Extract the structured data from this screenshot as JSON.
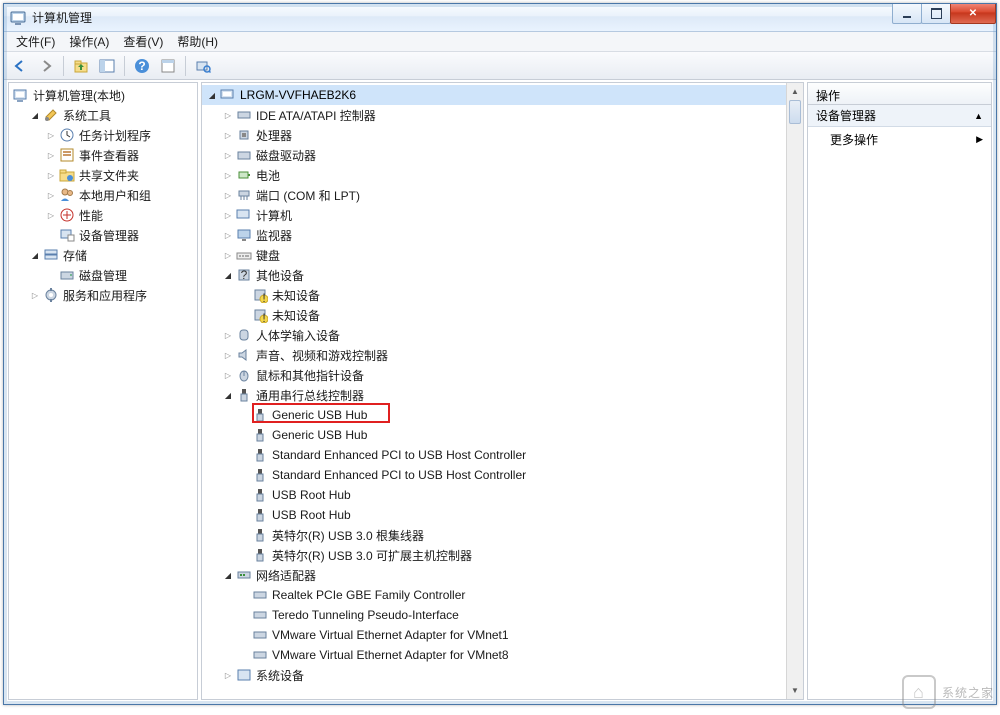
{
  "window": {
    "title": "计算机管理"
  },
  "menu": {
    "file": "文件(F)",
    "action": "操作(A)",
    "view": "查看(V)",
    "help": "帮助(H)"
  },
  "left_tree": {
    "root": "计算机管理(本地)",
    "systools": "系统工具",
    "task_scheduler": "任务计划程序",
    "event_viewer": "事件查看器",
    "shared_folders": "共享文件夹",
    "local_users": "本地用户和组",
    "performance": "性能",
    "device_manager": "设备管理器",
    "storage": "存储",
    "disk_mgmt": "磁盘管理",
    "services_apps": "服务和应用程序"
  },
  "mid_tree": {
    "computer": "LRGM-VVFHAEB2K6",
    "ide": "IDE ATA/ATAPI 控制器",
    "cpu": "处理器",
    "disk_drives": "磁盘驱动器",
    "battery": "电池",
    "ports": "端口 (COM 和 LPT)",
    "computers": "计算机",
    "monitors": "监视器",
    "keyboards": "键盘",
    "other_devices": "其他设备",
    "unknown1": "未知设备",
    "unknown2": "未知设备",
    "hid": "人体学输入设备",
    "sound": "声音、视频和游戏控制器",
    "mouse": "鼠标和其他指针设备",
    "usb_controllers": "通用串行总线控制器",
    "usb1": "Generic USB Hub",
    "usb2": "Generic USB Hub",
    "usb3": "Standard Enhanced PCI to USB Host Controller",
    "usb4": "Standard Enhanced PCI to USB Host Controller",
    "usb5": "USB Root Hub",
    "usb6": "USB Root Hub",
    "usb7": "英特尔(R) USB 3.0 根集线器",
    "usb8": "英特尔(R) USB 3.0 可扩展主机控制器",
    "net_adapters": "网络适配器",
    "net1": "Realtek PCIe GBE Family Controller",
    "net2": "Teredo Tunneling Pseudo-Interface",
    "net3": "VMware Virtual Ethernet Adapter for VMnet1",
    "net4": "VMware Virtual Ethernet Adapter for VMnet8",
    "system_devices": "系统设备"
  },
  "actions": {
    "header": "操作",
    "category": "设备管理器",
    "more": "更多操作"
  },
  "watermark": "系统之家"
}
